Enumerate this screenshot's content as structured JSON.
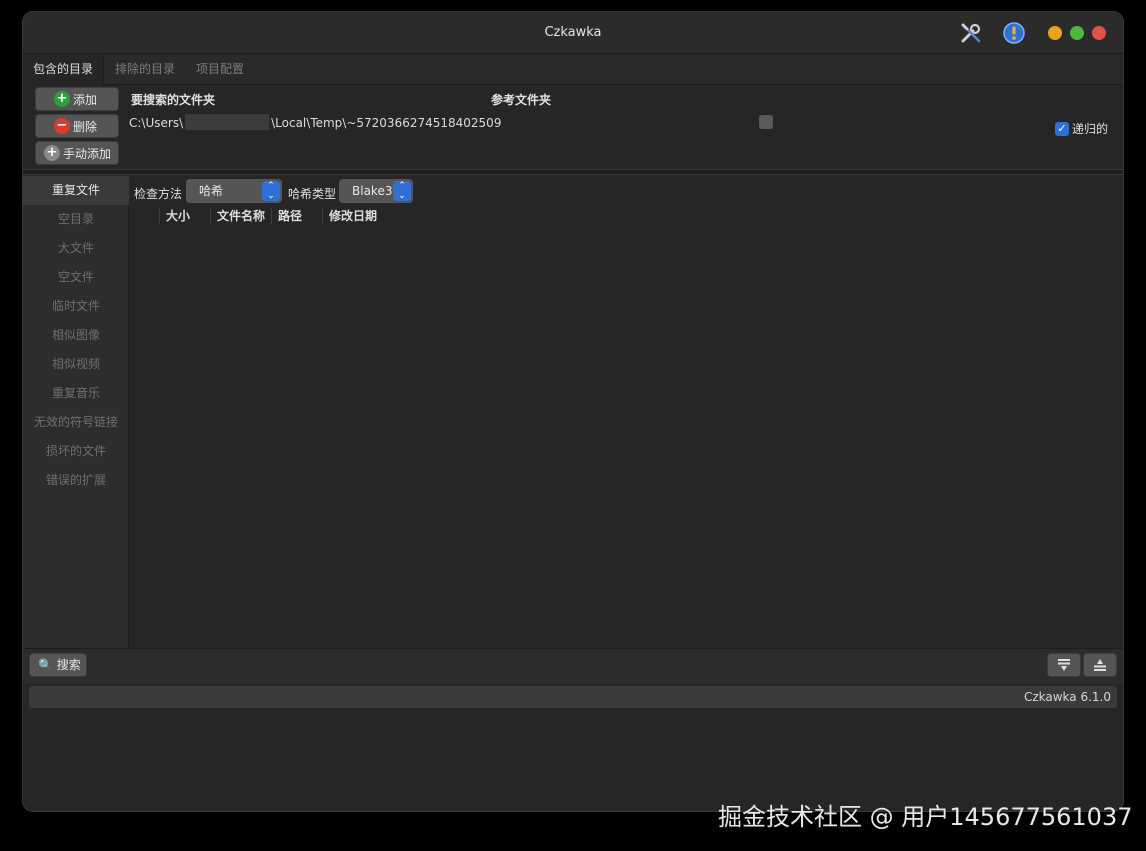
{
  "window": {
    "title": "Czkawka",
    "colors": {
      "min": "#e8a321",
      "max": "#4cb93c",
      "close": "#e0524c",
      "accent": "#2f6fd6"
    }
  },
  "tabs": [
    {
      "label": "包含的目录",
      "active": true
    },
    {
      "label": "排除的目录",
      "active": false
    },
    {
      "label": "项目配置",
      "active": false
    }
  ],
  "dirs": {
    "add_label": "添加",
    "remove_label": "删除",
    "manual_add_label": "手动添加",
    "col_search": "要搜索的文件夹",
    "col_reference": "参考文件夹",
    "path_prefix": "C:\\Users\\",
    "path_suffix": "\\Local\\Temp\\~5720366274518402509",
    "recursive_label": "递归的"
  },
  "nav": {
    "items": [
      {
        "label": "重复文件",
        "active": true
      },
      {
        "label": "空目录"
      },
      {
        "label": "大文件"
      },
      {
        "label": "空文件"
      },
      {
        "label": "临时文件"
      },
      {
        "label": "相似图像"
      },
      {
        "label": "相似视频"
      },
      {
        "label": "重复音乐"
      },
      {
        "label": "无效的符号链接"
      },
      {
        "label": "损坏的文件"
      },
      {
        "label": "错误的扩展"
      }
    ]
  },
  "main": {
    "check_method_label": "检查方法",
    "check_method_value": "哈希",
    "hash_type_label": "哈希类型",
    "hash_type_value": "Blake3",
    "columns": [
      "大小",
      "文件名称",
      "路径",
      "修改日期"
    ]
  },
  "bottom": {
    "search_label": "搜索",
    "version": "Czkawka 6.1.0"
  },
  "watermark": "掘金技术社区 @ 用户145677561037"
}
